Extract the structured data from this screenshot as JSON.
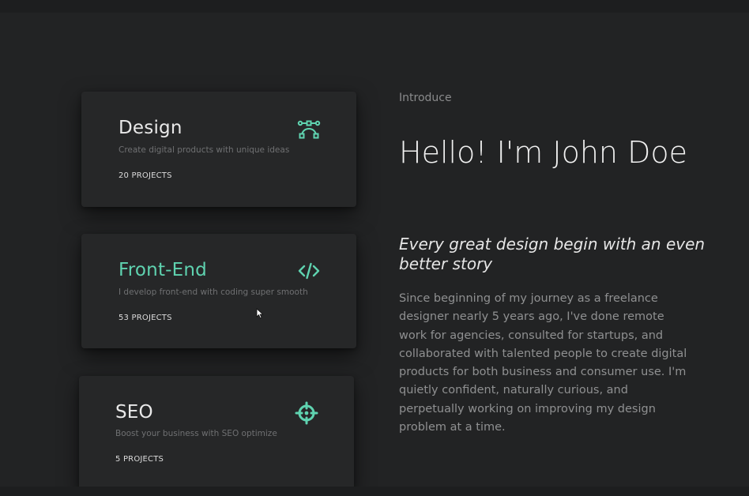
{
  "services": [
    {
      "title": "Design",
      "description": "Create digital products with unique ideas",
      "count": "20 PROJECTS",
      "icon": "bezier-curve-icon"
    },
    {
      "title": "Front-End",
      "description": "I develop front-end with coding super smooth",
      "count": "53 PROJECTS",
      "icon": "code-icon"
    },
    {
      "title": "SEO",
      "description": "Boost your business with SEO optimize",
      "count": "5 PROJECTS",
      "icon": "crosshair-icon"
    }
  ],
  "intro": {
    "label": "Introduce",
    "headline": "Hello! I'm John Doe",
    "tagline": "Every great design begin with an even better story",
    "bio": "Since beginning of my journey as a freelance designer nearly 5 years ago, I've done remote work for agencies, consulted for startups, and collaborated with talented people to create digital products for both business and consumer use. I'm quietly confident, naturally curious, and perpetually working on improving my design problem at a time."
  },
  "colors": {
    "background": "#222324",
    "card": "#262728",
    "accent": "#5fd3b0"
  }
}
